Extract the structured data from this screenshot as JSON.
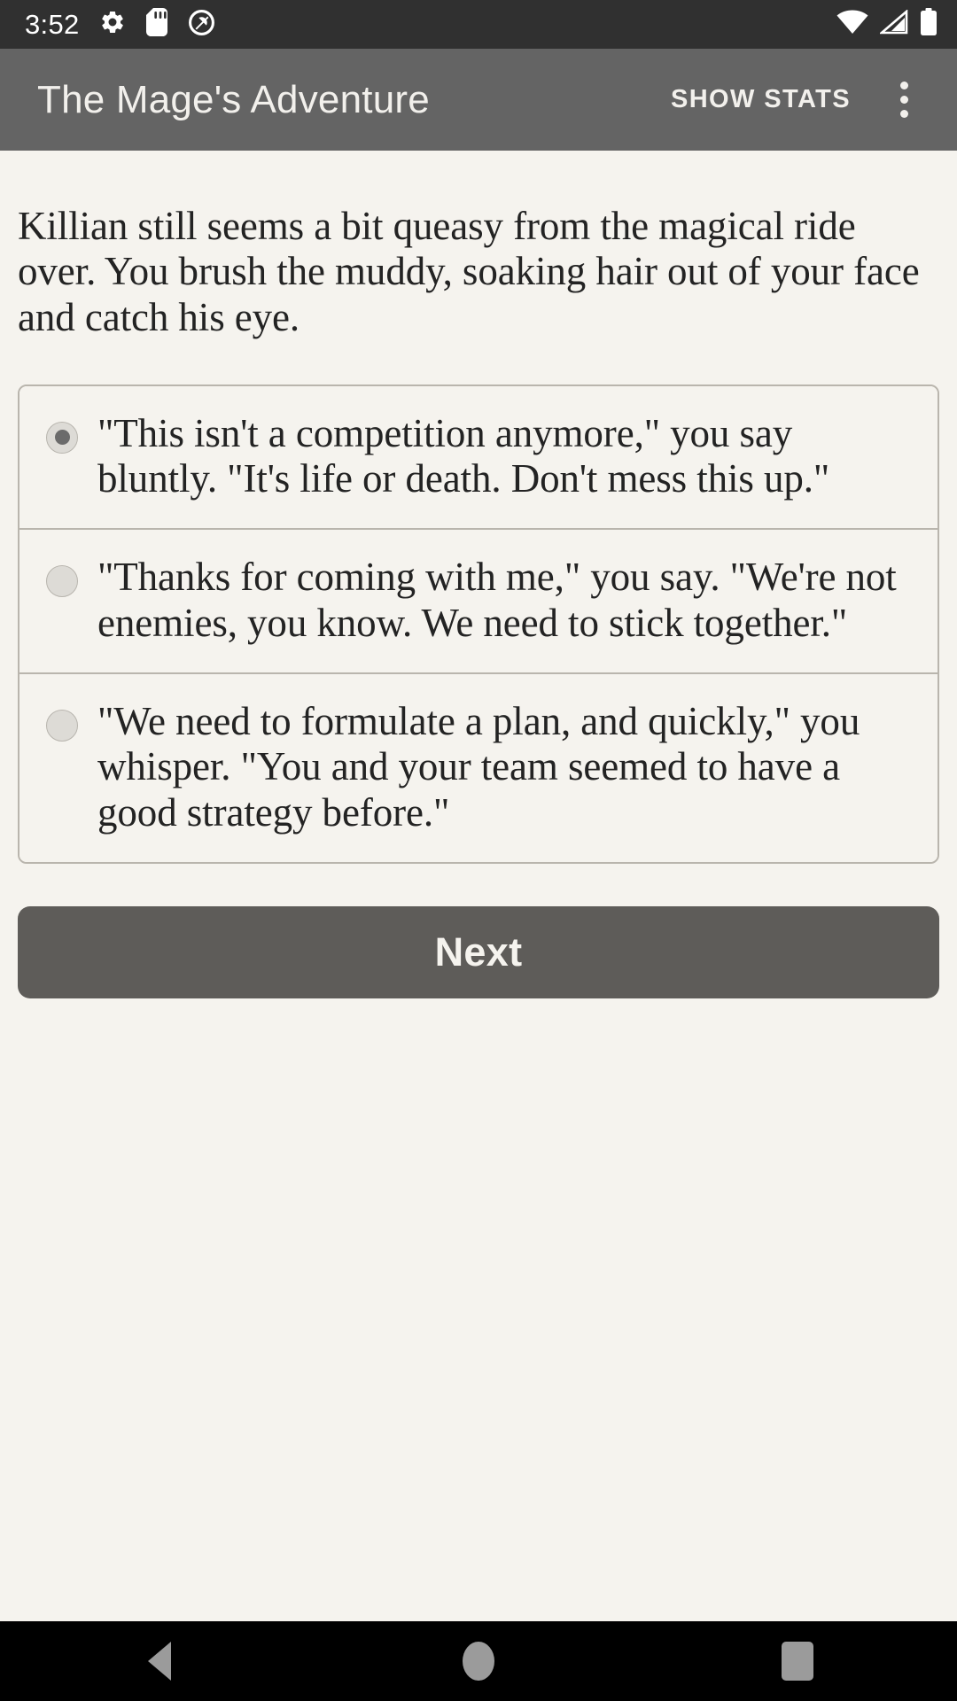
{
  "status_bar": {
    "time": "3:52",
    "left_icons": [
      "gear-icon",
      "sd-card-icon",
      "do-not-disturb-icon"
    ],
    "right_icons": [
      "wifi-icon",
      "cellular-signal-icon",
      "battery-icon"
    ],
    "background_color": "#303030"
  },
  "app_bar": {
    "title": "The Mage's Adventure",
    "action_label": "SHOW STATS",
    "overflow_icon": "more-vert-icon",
    "background_color": "#646464"
  },
  "main": {
    "narrative": "Killian still seems a bit queasy from the magical ride over. You brush the muddy, soaking hair out of your face and catch his eye.",
    "options": [
      {
        "text": "\"This isn't a competition anymore,\" you say bluntly. \"It's life or death. Don't mess this up.\"",
        "selected": true
      },
      {
        "text": "\"Thanks for coming with me,\" you say. \"We're not enemies, you know. We need to stick together.\"",
        "selected": false
      },
      {
        "text": "\"We need to formulate a plan, and quickly,\" you whisper. \"You and your team seemed to have a good strategy before.\"",
        "selected": false
      }
    ],
    "next_label": "Next",
    "background_color": "#f5f3ee"
  },
  "nav_bar": {
    "buttons": [
      "back-button",
      "home-button",
      "recents-button"
    ],
    "background_color": "#000000"
  }
}
